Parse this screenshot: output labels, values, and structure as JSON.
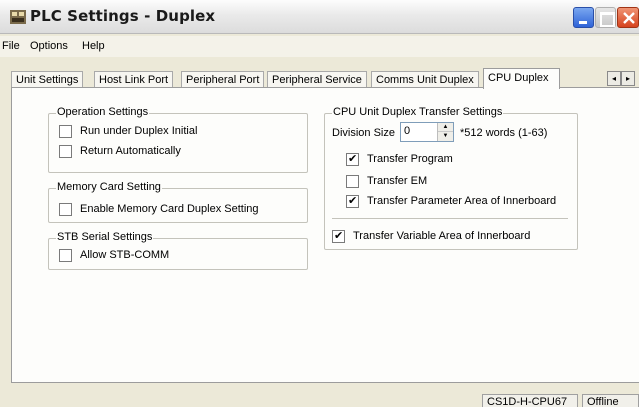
{
  "window": {
    "title": "PLC Settings - Duplex"
  },
  "menu": {
    "items": [
      "File",
      "Options",
      "Help"
    ]
  },
  "tabs": [
    {
      "label": "Unit Settings",
      "active": false
    },
    {
      "label": "Host Link Port",
      "active": false
    },
    {
      "label": "Peripheral Port",
      "active": false
    },
    {
      "label": "Peripheral Service",
      "active": false
    },
    {
      "label": "Comms Unit Duplex",
      "active": false
    },
    {
      "label": "CPU Duplex",
      "active": true
    }
  ],
  "tab_scroll": {
    "left": "◂",
    "right": "▸"
  },
  "operation_settings": {
    "title": "Operation Settings",
    "run_under_duplex_initial": {
      "label": "Run under Duplex Initial",
      "checked": false
    },
    "return_automatically": {
      "label": "Return Automatically",
      "checked": false
    }
  },
  "memory_card_setting": {
    "title": "Memory Card Setting",
    "enable_duplex": {
      "label": "Enable Memory Card Duplex Setting",
      "checked": false
    }
  },
  "stb_serial_settings": {
    "title": "STB Serial Settings",
    "allow_stb_comm": {
      "label": "Allow STB-COMM",
      "checked": false
    }
  },
  "cpu_transfer": {
    "title": "CPU Unit Duplex Transfer Settings",
    "division_size_label": "Division Size",
    "division_size_value": "0",
    "division_size_unit": "*512 words (1-63)",
    "transfer_program": {
      "label": "Transfer Program",
      "checked": true
    },
    "transfer_em": {
      "label": "Transfer EM",
      "checked": false
    },
    "transfer_parameter": {
      "label": "Transfer Parameter Area of Innerboard",
      "checked": true
    },
    "transfer_variable": {
      "label": "Transfer Variable Area of Innerboard",
      "checked": true
    }
  },
  "status": {
    "model": "CS1D-H-CPU67",
    "connection": "Offline"
  },
  "colors": {
    "close_button": "#d6431e",
    "minimize_button": "#2f63d7",
    "tab_panel": "#fdfdfb"
  }
}
